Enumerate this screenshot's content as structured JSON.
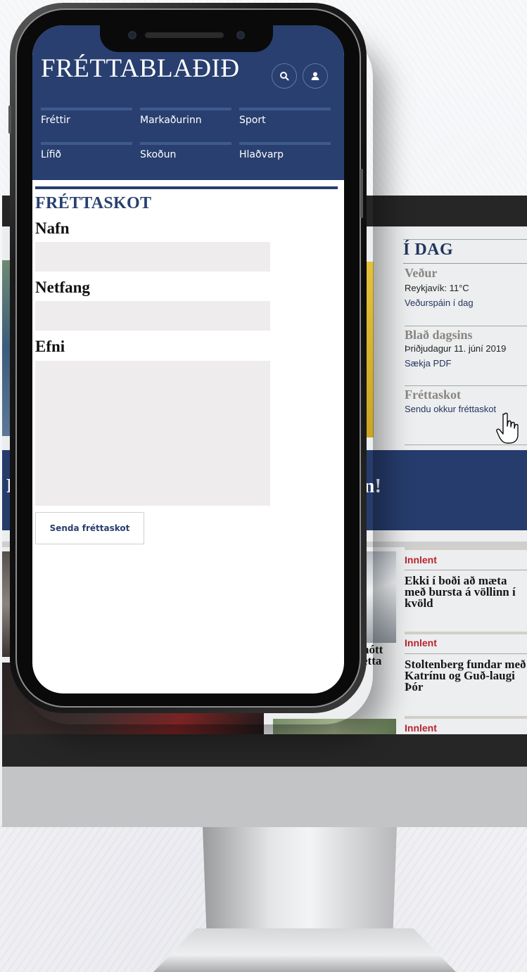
{
  "phone": {
    "logo": "FRÉTTABLAÐIÐ",
    "nav": [
      {
        "label": "Fréttir"
      },
      {
        "label": "Markaðurinn"
      },
      {
        "label": "Sport"
      },
      {
        "label": "Lífið"
      },
      {
        "label": "Skoðun"
      },
      {
        "label": "Hlaðvarp"
      }
    ],
    "icons": {
      "search": "search-icon",
      "user": "user-icon"
    },
    "form": {
      "heading": "FRÉTTASKOT",
      "name_label": "Nafn",
      "email_label": "Netfang",
      "subject_label": "Efni",
      "name_value": "",
      "email_value": "",
      "subject_value": "",
      "submit_label": "Senda fréttaskot"
    },
    "colors": {
      "brand": "#283f6f",
      "input_bg": "#eeecec"
    }
  },
  "desktop": {
    "idag": {
      "title": "Í DAG",
      "weather_title": "Veður",
      "weather_line": "Reykjavík: 11°C",
      "weather_link": "Veðurspáin í dag",
      "paper_title": "Blað dagsins",
      "paper_date": "Þriðjudagur 11. júní 2019",
      "paper_link": "Sækja PDF",
      "tip_title": "Fréttaskot",
      "tip_link": "Sendu okkur fréttaskot"
    },
    "banner": {
      "left_fragment": "F",
      "right_fragment": "n!"
    },
    "articles": [
      {
        "topic": "Innlent",
        "headline": "Ekki í boði að mæta með bursta á völlinn í kvöld"
      },
      {
        "topic": "Innlent",
        "headline": "Stoltenberg fundar með Katrínu og Guð-laugi Þór"
      },
      {
        "topic": "Innlent",
        "headline": ""
      }
    ],
    "cut_headline": "nótt etta",
    "colors": {
      "accent_red": "#b7252d",
      "brand": "#263c6c"
    }
  }
}
